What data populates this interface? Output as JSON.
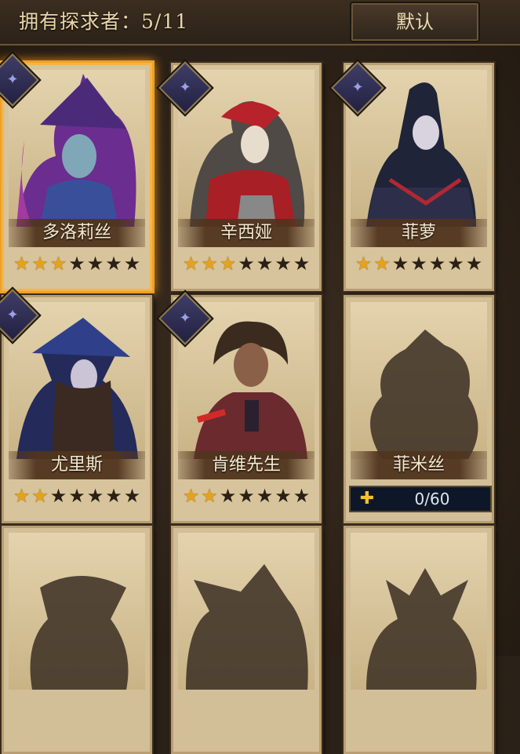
{
  "header": {
    "owned_label": "拥有探求者：5/11",
    "default_button": "默认"
  },
  "cards": [
    {
      "name": "多洛莉丝",
      "stars": 3,
      "max_stars": 7,
      "selected": true,
      "unlocked": true
    },
    {
      "name": "辛西娅",
      "stars": 3,
      "max_stars": 7,
      "selected": false,
      "unlocked": true
    },
    {
      "name": "菲萝",
      "stars": 2,
      "max_stars": 7,
      "selected": false,
      "unlocked": true
    },
    {
      "name": "尤里斯",
      "stars": 2,
      "max_stars": 7,
      "selected": false,
      "unlocked": true
    },
    {
      "name": "肯维先生",
      "stars": 2,
      "max_stars": 7,
      "selected": false,
      "unlocked": true
    },
    {
      "name": "菲米丝",
      "unlocked": false,
      "progress": "0/60"
    },
    {
      "unlocked": false
    },
    {
      "unlocked": false
    },
    {
      "unlocked": false
    }
  ],
  "icons": {
    "class_badge": "class-emblem-icon",
    "puzzle": "puzzle-piece-icon",
    "star": "star-icon"
  },
  "colors": {
    "star_on": "#e6a21c",
    "star_off": "#2a2016",
    "selected_glow": "#f0a028",
    "badge": "#3f3d66"
  }
}
